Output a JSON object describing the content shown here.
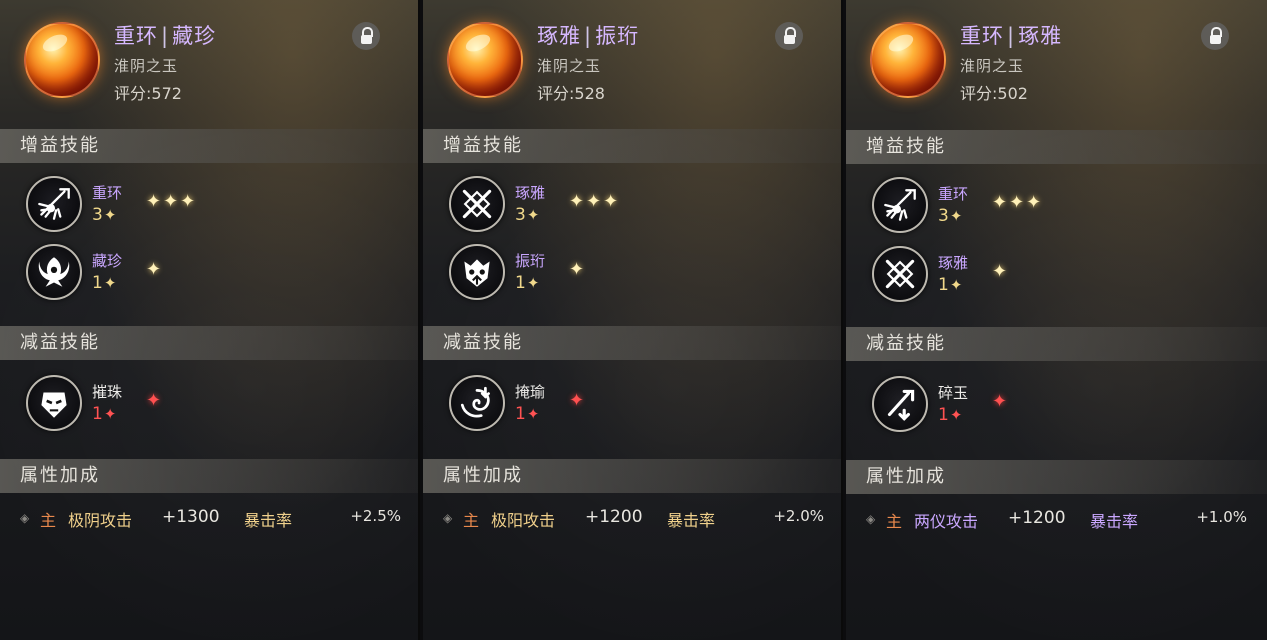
{
  "panels": [
    {
      "title_a": "重环",
      "title_sep": "|",
      "title_b": "藏珍",
      "subtitle": "淮阴之玉",
      "score": "评分:572",
      "buff_header": "增益技能",
      "buffs": [
        {
          "name": "重环",
          "level": "3",
          "level_star": "✦",
          "stars": "✦✦✦",
          "icon": "sword-burst-icon"
        },
        {
          "name": "藏珍",
          "level": "1",
          "level_star": "✦",
          "stars": "✦",
          "icon": "phoenix-icon"
        }
      ],
      "debuff_header": "减益技能",
      "debuff": {
        "name": "摧珠",
        "level": "1",
        "level_star": "✦",
        "stars": "✦",
        "icon": "mask-icon"
      },
      "attr_header": "属性加成",
      "attr": {
        "diamond": "◈",
        "main_tag": "主",
        "attr_name": "极阴攻击",
        "attr_value": "+1300",
        "crit_name": "暴击率",
        "crit_value": "+2.5%"
      }
    },
    {
      "title_a": "琢雅",
      "title_sep": "|",
      "title_b": "振珩",
      "subtitle": "淮阴之玉",
      "score": "评分:528",
      "buff_header": "增益技能",
      "buffs": [
        {
          "name": "琢雅",
          "level": "3",
          "level_star": "✦",
          "stars": "✦✦✦",
          "icon": "crossed-swords-icon"
        },
        {
          "name": "振珩",
          "level": "1",
          "level_star": "✦",
          "stars": "✦",
          "icon": "demon-face-icon"
        }
      ],
      "debuff_header": "减益技能",
      "debuff": {
        "name": "掩瑜",
        "level": "1",
        "level_star": "✦",
        "stars": "✦",
        "icon": "vortex-icon"
      },
      "attr_header": "属性加成",
      "attr": {
        "diamond": "◈",
        "main_tag": "主",
        "attr_name": "极阳攻击",
        "attr_value": "+1200",
        "crit_name": "暴击率",
        "crit_value": "+2.0%"
      }
    },
    {
      "title_a": "重环",
      "title_sep": "|",
      "title_b": "琢雅",
      "subtitle": "淮阴之玉",
      "score": "评分:502",
      "buff_header": "增益技能",
      "buffs": [
        {
          "name": "重环",
          "level": "3",
          "level_star": "✦",
          "stars": "✦✦✦",
          "icon": "sword-burst-icon"
        },
        {
          "name": "琢雅",
          "level": "1",
          "level_star": "✦",
          "stars": "✦",
          "icon": "crossed-swords-icon"
        }
      ],
      "debuff_header": "减益技能",
      "debuff": {
        "name": "碎玉",
        "level": "1",
        "level_star": "✦",
        "stars": "✦",
        "icon": "broken-sword-icon"
      },
      "attr_header": "属性加成",
      "attr": {
        "diamond": "◈",
        "main_tag": "主",
        "attr_name": "两仪攻击",
        "attr_value": "+1200",
        "crit_name": "暴击率",
        "crit_value": "+1.0%"
      }
    }
  ],
  "colors": {
    "title": "#d6b8ff",
    "buff_name": "#c9a6ff",
    "gold_level": "#f0d88a",
    "debuff_red": "#ff4d4d",
    "main_tag": "#e8884c"
  }
}
